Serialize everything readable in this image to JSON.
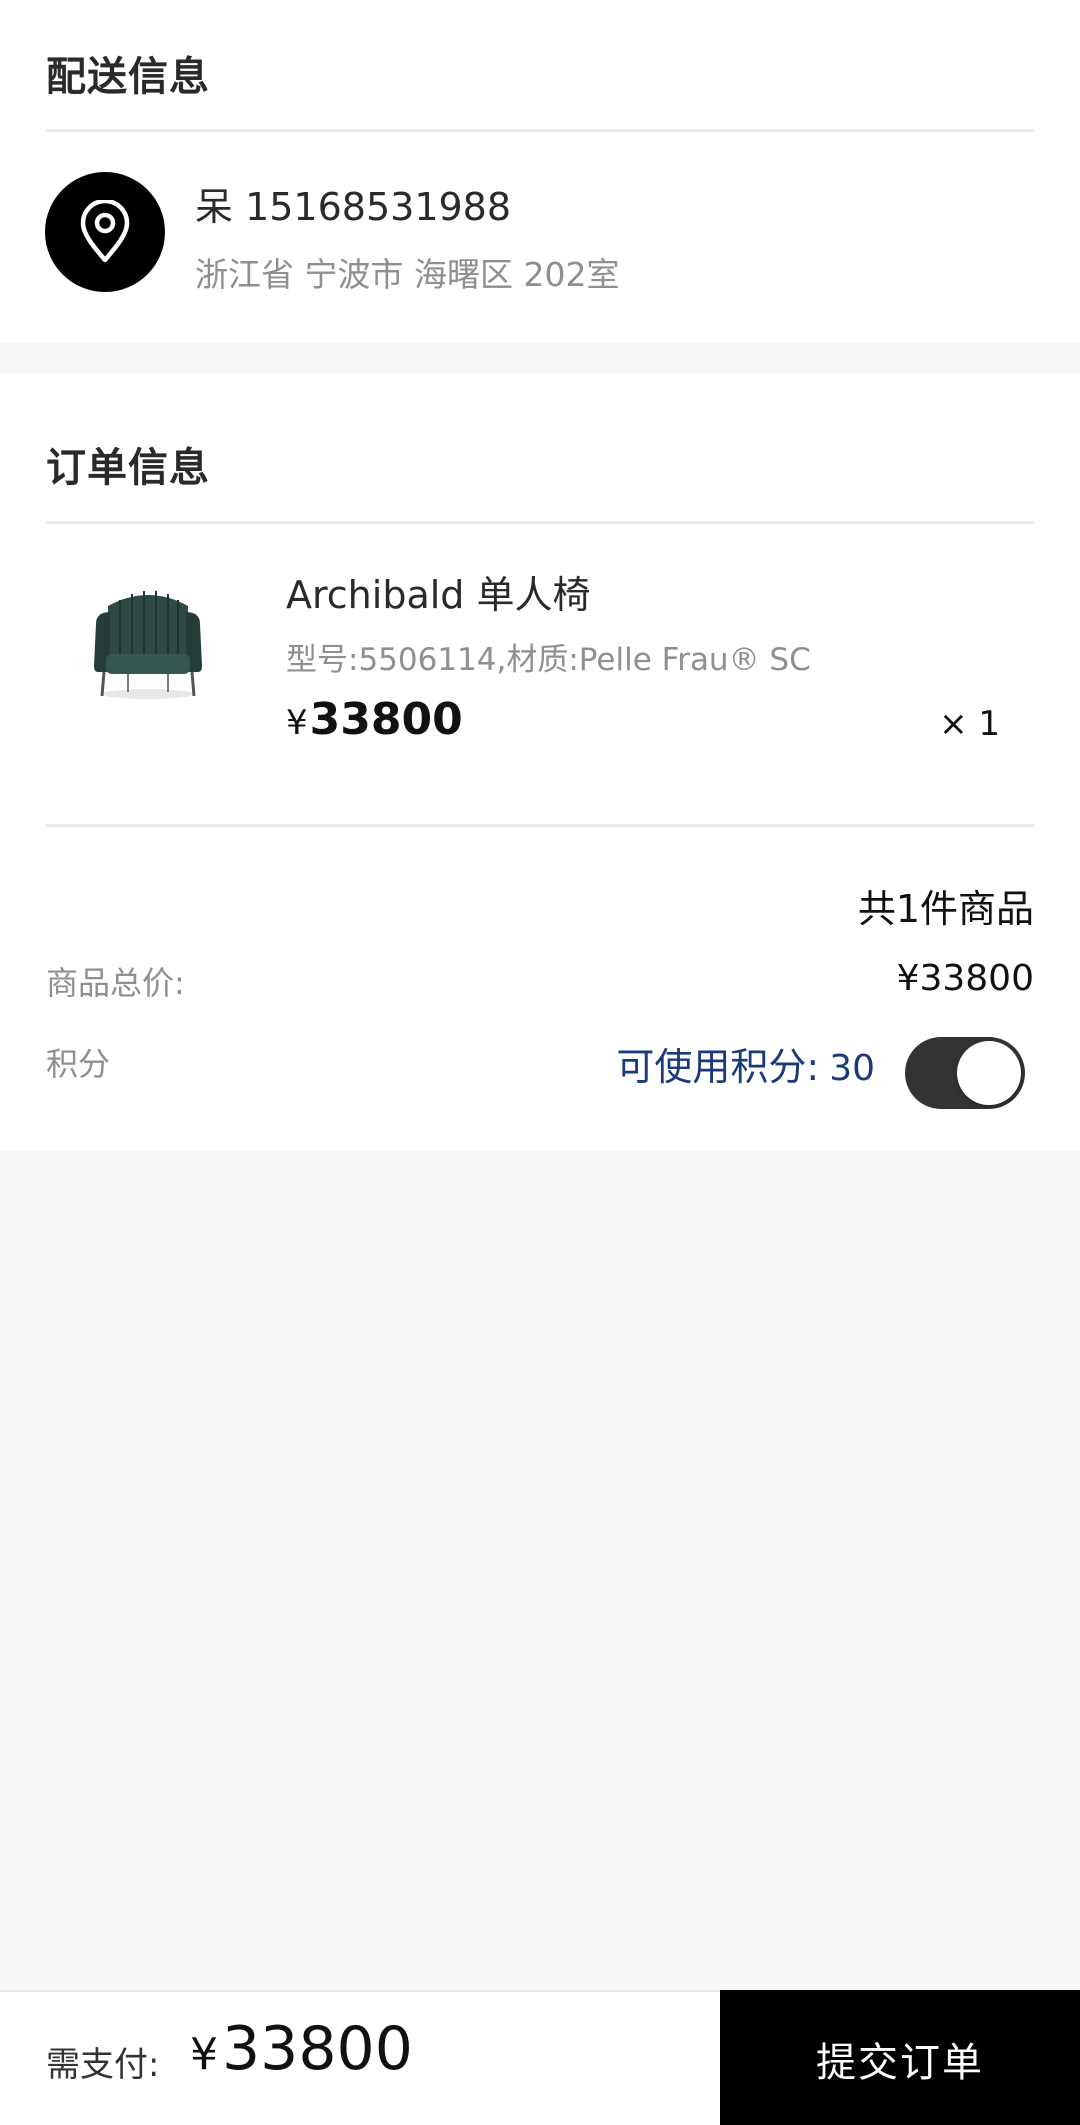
{
  "delivery": {
    "title": "配送信息",
    "contact": "呆 15168531988",
    "address": "浙江省 宁波市 海曙区 202室",
    "icon": "map-pin-icon"
  },
  "order": {
    "title": "订单信息",
    "product": {
      "name": "Archibald 单人椅",
      "spec": "型号:5506114,材质:Pelle Frau® SC",
      "currency": "¥",
      "price": "33800",
      "quantity": "× 1",
      "image": "armchair-image"
    },
    "item_count": "共1件商品",
    "total_label": "商品总价:",
    "total_value": "¥33800",
    "points_label": "积分",
    "points_available_label": "可使用积分:",
    "points_available_value": "30",
    "points_toggle_on": true
  },
  "footer": {
    "pay_label": "需支付:",
    "currency": "¥",
    "pay_amount": "33800",
    "submit_label": "提交订单"
  },
  "colors": {
    "primary": "#000000",
    "points_text": "#1a3a7a",
    "toggle_on": "#333333",
    "muted_text": "#8f8f8f",
    "page_bg": "#f6f6f6"
  }
}
